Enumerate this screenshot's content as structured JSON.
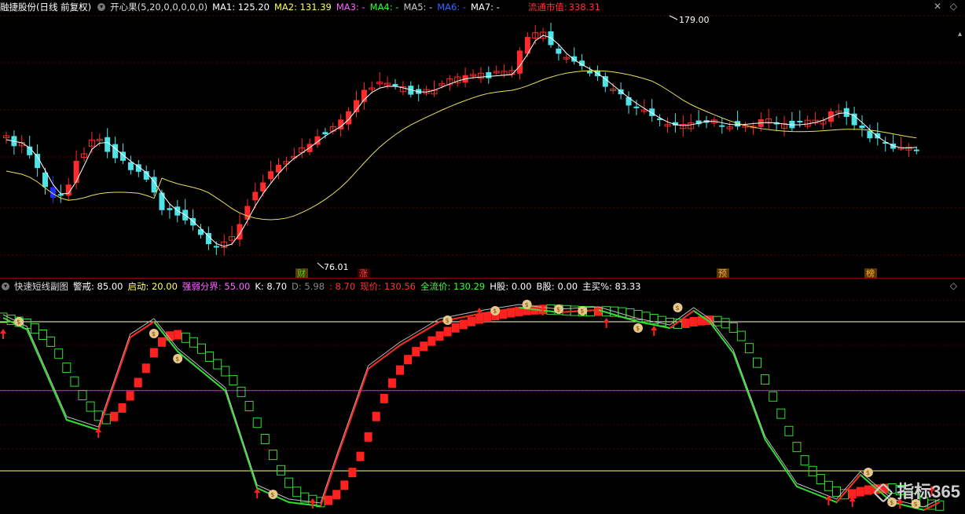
{
  "top": {
    "stock_name": "融捷股份(日线 前复权)",
    "indicator": "开心果(5,20,0,0,0,0,0)",
    "ma": [
      {
        "label": "MA1:",
        "value": "125.20",
        "color": "#ffffff"
      },
      {
        "label": "MA2:",
        "value": "131.39",
        "color": "#ffff66"
      },
      {
        "label": "MA3:",
        "value": "-",
        "color": "#ff66ff"
      },
      {
        "label": "MA4:",
        "value": "-",
        "color": "#33ff33"
      },
      {
        "label": "MA5:",
        "value": "-",
        "color": "#cccccc"
      },
      {
        "label": "MA6:",
        "value": "-",
        "color": "#3366ff"
      },
      {
        "label": "MA7:",
        "value": "-",
        "color": "#ffffff"
      }
    ],
    "market_cap_label": "流通市值:",
    "market_cap_value": "338.31",
    "high_label": "179.00",
    "low_label": "76.01"
  },
  "markers": [
    {
      "text": "财",
      "color": "#33cc33"
    },
    {
      "text": "涨",
      "color": "#ff4444"
    },
    {
      "text": "预",
      "color": "#ffaa33"
    },
    {
      "text": "榜",
      "color": "#ffaa33"
    }
  ],
  "sub": {
    "name": "快速短线副图",
    "items": [
      {
        "label": "警戒:",
        "value": "85.00",
        "color": "#ffffff"
      },
      {
        "label": "启动:",
        "value": "20.00",
        "color": "#ffff66"
      },
      {
        "label": "强弱分界:",
        "value": "55.00",
        "color": "#ff66ff"
      },
      {
        "label": "K:",
        "value": "8.70",
        "color": "#ffffff"
      },
      {
        "label": "D:",
        "value": "5.98",
        "color": "#888888"
      },
      {
        "label": ":",
        "value": "8.70",
        "color": "#ff3333"
      },
      {
        "label": "现价:",
        "value": "130.56",
        "color": "#ff3333"
      },
      {
        "label": "全流价:",
        "value": "130.29",
        "color": "#33ff33"
      },
      {
        "label": "H股:",
        "value": "0.00",
        "color": "#ffffff"
      },
      {
        "label": "B股:",
        "value": "0.00",
        "color": "#ffffff"
      },
      {
        "label": "主买%:",
        "value": "83.33",
        "color": "#ffffff"
      }
    ]
  },
  "watermark": "指标365",
  "colors": {
    "up": "#ff2a2a",
    "down": "#4fe3e8",
    "big_down": "#1f2cff",
    "ma1": "#ffffff",
    "ma2": "#e8e060",
    "k_line": "#33dd33",
    "red_line": "#ff2020"
  },
  "chart_data": {
    "type": "candlestick",
    "series": [
      {
        "name": "MA1",
        "values": []
      },
      {
        "name": "MA2",
        "values": []
      }
    ],
    "price_high": 179.0,
    "price_low": 76.01,
    "sub_levels": [
      85,
      55,
      20
    ]
  }
}
